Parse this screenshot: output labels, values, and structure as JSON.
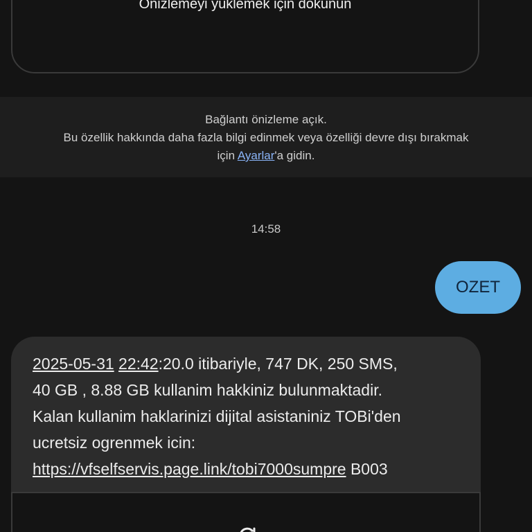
{
  "preview_card": {
    "tap_label": "Önizlemeyi yüklemek için dokunun",
    "icon": "reload-icon"
  },
  "notice": {
    "line1": "Bağlantı önizleme açık.",
    "line2": "Bu özellik hakkında daha fazla bilgi edinmek veya özelliği devre dışı bırakmak",
    "line3_prefix": "için ",
    "settings_link": "Ayarlar",
    "line3_suffix": "'a gidin."
  },
  "conversation": {
    "timestamp": "14:58",
    "sent_message": "OZET",
    "received": {
      "date": "2025-05-31",
      "time_hm": "22:42",
      "line1_rest": ":20.0 itibariyle,  747 DK,  250 SMS,",
      "line2": "40 GB , 8.88 GB  kullanim hakkiniz bulunmaktadir.",
      "line3": "Kalan kullanim haklarinizi dijital asistaniniz TOBi'den",
      "line4": "ucretsiz ogrenmek icin:",
      "link": "https://vfselfservis.page.link/tobi7000sumpre",
      "code": "B003"
    }
  },
  "colors": {
    "background": "#141414",
    "sent_bubble": "#5dade2",
    "received_bubble": "#2c2c2c",
    "link": "#8ab4f8"
  }
}
